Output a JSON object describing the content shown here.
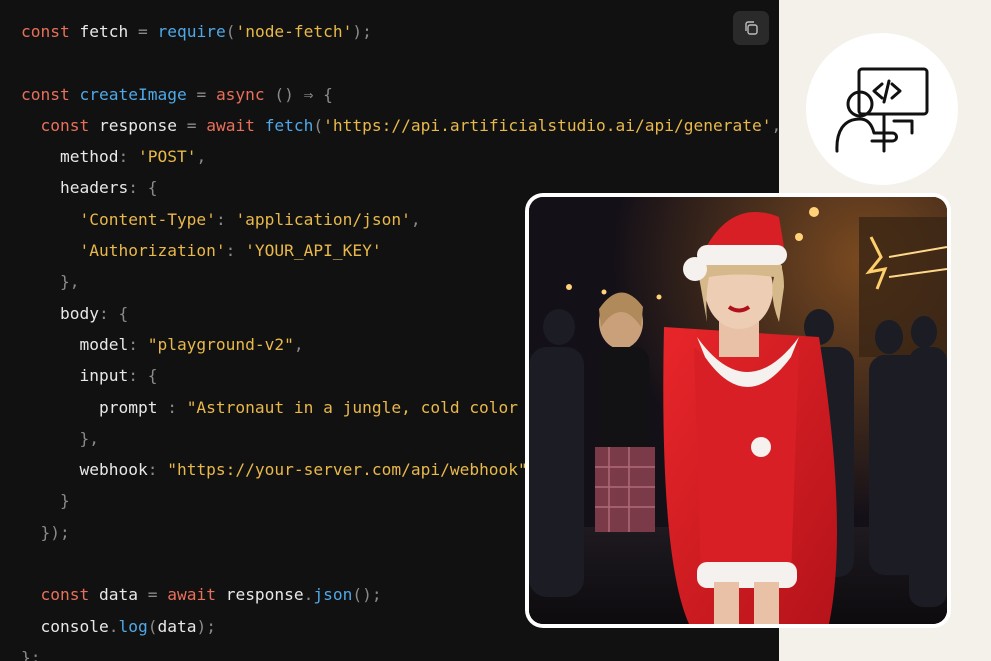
{
  "code": {
    "lines": [
      [
        [
          "kw",
          "const"
        ],
        [
          "tx",
          " fetch "
        ],
        [
          "pn",
          "= "
        ],
        [
          "fn",
          "require"
        ],
        [
          "pn",
          "("
        ],
        [
          "str",
          "'node-fetch'"
        ],
        [
          "pn",
          ");"
        ]
      ],
      [],
      [
        [
          "kw",
          "const"
        ],
        [
          "tx",
          " "
        ],
        [
          "fn",
          "createImage"
        ],
        [
          "tx",
          " "
        ],
        [
          "pn",
          "= "
        ],
        [
          "kw",
          "async"
        ],
        [
          "tx",
          " "
        ],
        [
          "pn",
          "() ⇒ {"
        ]
      ],
      [
        [
          "tx",
          "  "
        ],
        [
          "kw",
          "const"
        ],
        [
          "tx",
          " response "
        ],
        [
          "pn",
          "= "
        ],
        [
          "kw",
          "await"
        ],
        [
          "tx",
          " "
        ],
        [
          "fn",
          "fetch"
        ],
        [
          "pn",
          "("
        ],
        [
          "str",
          "'https://api.artificialstudio.ai/api/generate'"
        ],
        [
          "pn",
          ", {"
        ]
      ],
      [
        [
          "tx",
          "    method"
        ],
        [
          "pn",
          ": "
        ],
        [
          "str",
          "'POST'"
        ],
        [
          "pn",
          ","
        ]
      ],
      [
        [
          "tx",
          "    headers"
        ],
        [
          "pn",
          ": {"
        ]
      ],
      [
        [
          "tx",
          "      "
        ],
        [
          "str",
          "'Content-Type'"
        ],
        [
          "pn",
          ": "
        ],
        [
          "str",
          "'application/json'"
        ],
        [
          "pn",
          ","
        ]
      ],
      [
        [
          "tx",
          "      "
        ],
        [
          "str",
          "'Authorization'"
        ],
        [
          "pn",
          ": "
        ],
        [
          "str",
          "'YOUR_API_KEY'"
        ]
      ],
      [
        [
          "tx",
          "    "
        ],
        [
          "pn",
          "},"
        ]
      ],
      [
        [
          "tx",
          "    body"
        ],
        [
          "pn",
          ": {"
        ]
      ],
      [
        [
          "tx",
          "      model"
        ],
        [
          "pn",
          ": "
        ],
        [
          "str",
          "\"playground-v2\""
        ],
        [
          "pn",
          ","
        ]
      ],
      [
        [
          "tx",
          "      input"
        ],
        [
          "pn",
          ": {"
        ]
      ],
      [
        [
          "tx",
          "        prompt "
        ],
        [
          "pn",
          ": "
        ],
        [
          "str",
          "\"Astronaut in a jungle, cold color palette\""
        ]
      ],
      [
        [
          "tx",
          "      "
        ],
        [
          "pn",
          "},"
        ]
      ],
      [
        [
          "tx",
          "      webhook"
        ],
        [
          "pn",
          ": "
        ],
        [
          "str",
          "\"https://your-server.com/api/webhook\""
        ]
      ],
      [
        [
          "tx",
          "    "
        ],
        [
          "pn",
          "}"
        ]
      ],
      [
        [
          "tx",
          "  "
        ],
        [
          "pn",
          "});"
        ]
      ],
      [],
      [
        [
          "tx",
          "  "
        ],
        [
          "kw",
          "const"
        ],
        [
          "tx",
          " data "
        ],
        [
          "pn",
          "= "
        ],
        [
          "kw",
          "await"
        ],
        [
          "tx",
          " response"
        ],
        [
          "pn",
          "."
        ],
        [
          "fn",
          "json"
        ],
        [
          "pn",
          "();"
        ]
      ],
      [
        [
          "tx",
          "  console"
        ],
        [
          "pn",
          "."
        ],
        [
          "fn",
          "log"
        ],
        [
          "pn",
          "("
        ],
        [
          "tx",
          "data"
        ],
        [
          "pn",
          ");"
        ]
      ],
      [
        [
          "pn",
          "};"
        ]
      ]
    ]
  },
  "copy_button": {
    "icon": "copy-icon"
  },
  "avatar": {
    "icon": "developer-at-computer-icon"
  },
  "photo": {
    "subject": "person-in-red-santa-dress-photo"
  },
  "colors": {
    "keyword": "#e8705a",
    "function": "#4fa8e8",
    "string": "#e8b84a",
    "punctuation": "#8a8a8a",
    "text": "#e8e8e8",
    "code_bg": "#111111",
    "page_bg": "#f4f1ea"
  }
}
